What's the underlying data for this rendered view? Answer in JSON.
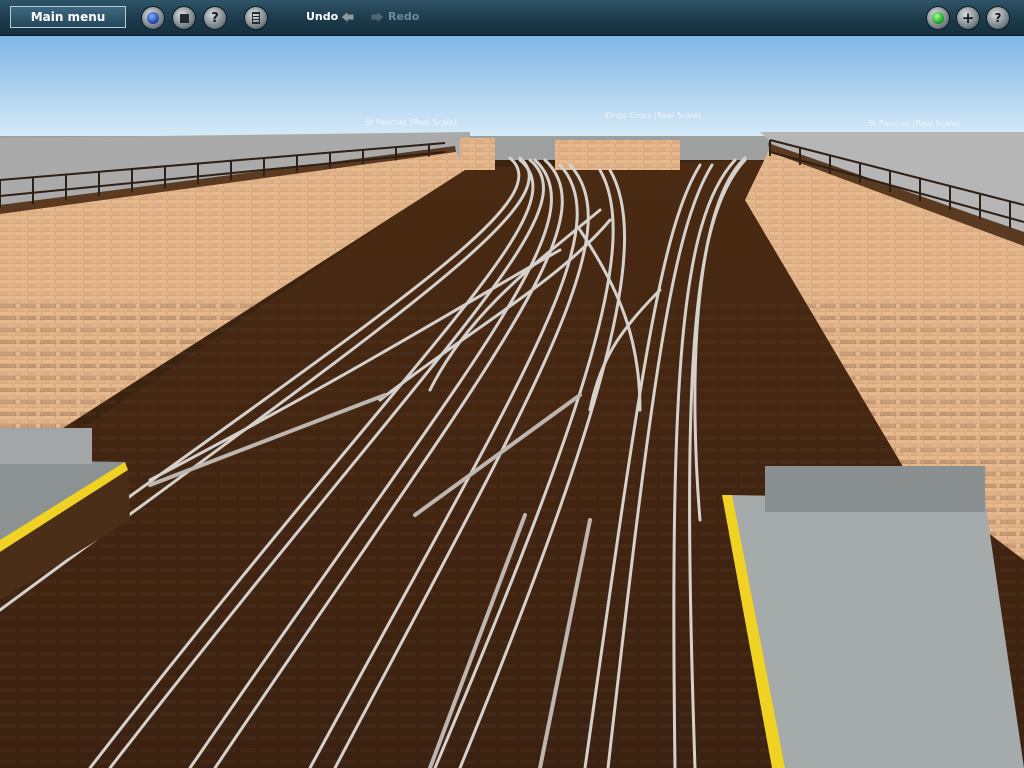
{
  "toolbar": {
    "main_menu_label": "Main menu",
    "undo_label": "Undo",
    "redo_label": "Redo",
    "left_icons": [
      "globe-icon",
      "stop-icon",
      "tool-icon",
      "layers-icon"
    ],
    "right_icons": [
      "status-light-icon",
      "add-icon",
      "help-icon"
    ],
    "status_color": "#1fa31f"
  },
  "scene": {
    "station_labels": [
      "St Pancras (Real Scale)",
      "Kings Cross (Real Scale)",
      "St Pancras (Real Scale)"
    ]
  }
}
